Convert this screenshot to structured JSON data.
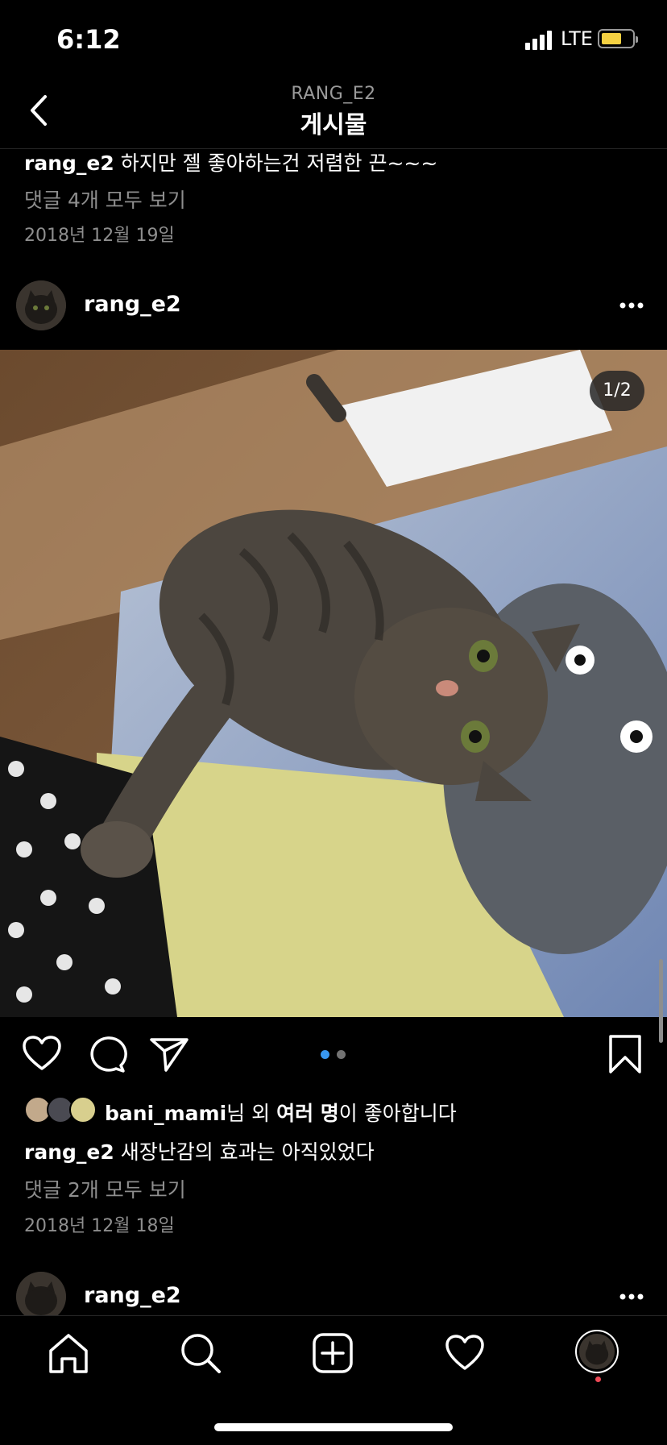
{
  "status": {
    "time": "6:12",
    "network": "LTE"
  },
  "header": {
    "subtitle": "RANG_E2",
    "title": "게시물"
  },
  "prev_post": {
    "caption_user": "rang_e2",
    "caption_text": " 하지만 젤 좋아하는건 저렴한 끈~~~",
    "view_comments": "댓글 4개 모두 보기",
    "date": "2018년 12월 19일"
  },
  "post": {
    "username": "rang_e2",
    "photo_counter": "1/2",
    "carousel": {
      "count": 2,
      "active": 0,
      "active_color": "#3897f0",
      "inactive_color": "#737373"
    },
    "likes": {
      "user": "bani_mami",
      "mid": "님 외 ",
      "many": "여러 명",
      "suffix": "이 좋아합니다"
    },
    "caption_user": "rang_e2",
    "caption_text": " 새장난감의 효과는 아직있었다",
    "view_comments": "댓글 2개 모두 보기",
    "date": "2018년 12월 18일"
  },
  "next_post": {
    "username": "rang_e2"
  },
  "tabbar": {
    "items": [
      "home",
      "search",
      "create",
      "activity",
      "profile"
    ],
    "notification_dot_color": "#ed4956"
  }
}
